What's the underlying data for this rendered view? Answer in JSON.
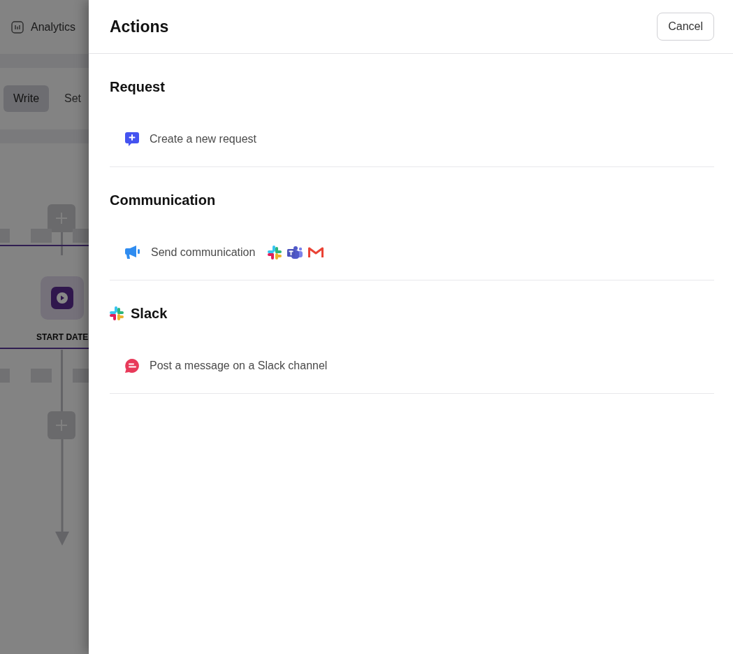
{
  "background": {
    "nav_item": "Analytics",
    "tabs": [
      {
        "label": "Write",
        "selected": true
      },
      {
        "label": "Set",
        "selected": false
      }
    ],
    "flow": {
      "node_label": "START DATE"
    }
  },
  "panel": {
    "title": "Actions",
    "cancel": "Cancel",
    "sections": [
      {
        "title": "Request",
        "kind": "plain",
        "items": [
          {
            "label": "Create a new request",
            "kind": "request"
          }
        ]
      },
      {
        "title": "Communication",
        "kind": "plain",
        "items": [
          {
            "label": "Send communication",
            "kind": "broadcast"
          }
        ]
      },
      {
        "title": "Slack",
        "kind": "slack",
        "items": [
          {
            "label": "Post a message on a Slack channel",
            "kind": "message"
          }
        ]
      }
    ]
  }
}
